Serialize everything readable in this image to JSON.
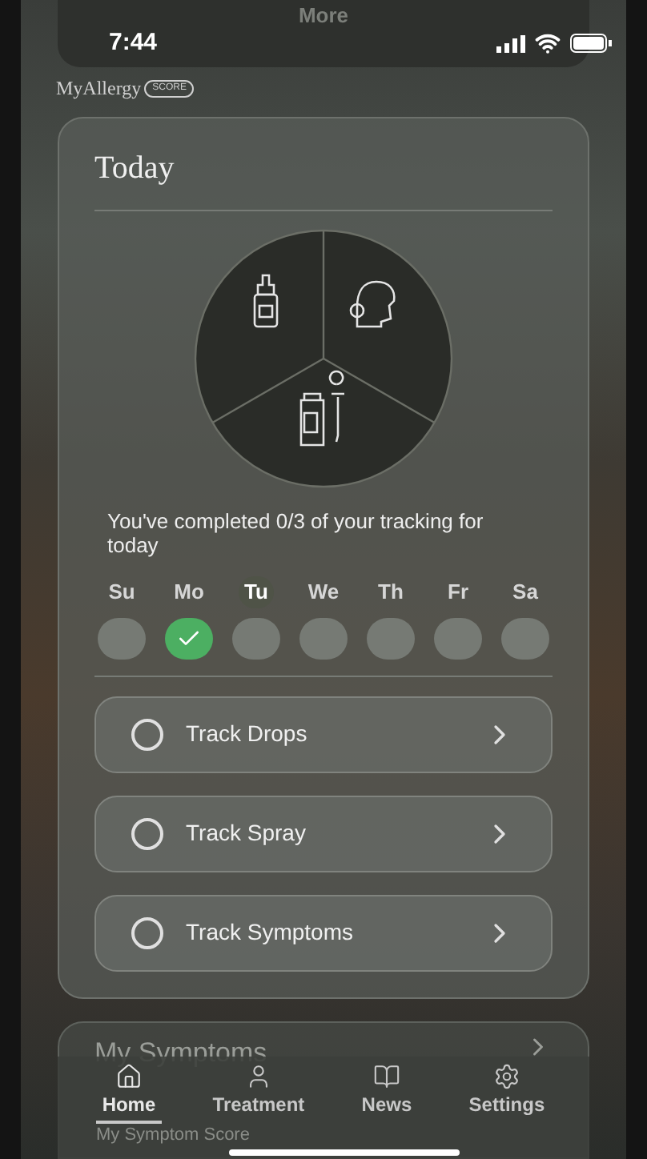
{
  "top_card": {
    "title": "More"
  },
  "status_bar": {
    "time": "7:44"
  },
  "logo": {
    "name": "MyAllergy",
    "badge": "SCORE"
  },
  "today": {
    "title": "Today",
    "progress_text": "You've completed 0/3 of your tracking for today",
    "days": [
      {
        "label": "Su",
        "selected": false,
        "checked": false
      },
      {
        "label": "Mo",
        "selected": false,
        "checked": true
      },
      {
        "label": "Tu",
        "selected": true,
        "checked": false
      },
      {
        "label": "We",
        "selected": false,
        "checked": false
      },
      {
        "label": "Th",
        "selected": false,
        "checked": false
      },
      {
        "label": "Fr",
        "selected": false,
        "checked": false
      },
      {
        "label": "Sa",
        "selected": false,
        "checked": false
      }
    ],
    "tasks": [
      {
        "label": "Track Drops",
        "checked": false
      },
      {
        "label": "Track Spray",
        "checked": false
      },
      {
        "label": "Track Symptoms",
        "checked": false
      }
    ]
  },
  "symptoms_card": {
    "title": "My Symptoms",
    "subtitle": "My Symptom Score"
  },
  "tab_bar": [
    {
      "label": "Home",
      "selected": true
    },
    {
      "label": "Treatment",
      "selected": false
    },
    {
      "label": "News",
      "selected": false
    },
    {
      "label": "Settings",
      "selected": false
    }
  ]
}
